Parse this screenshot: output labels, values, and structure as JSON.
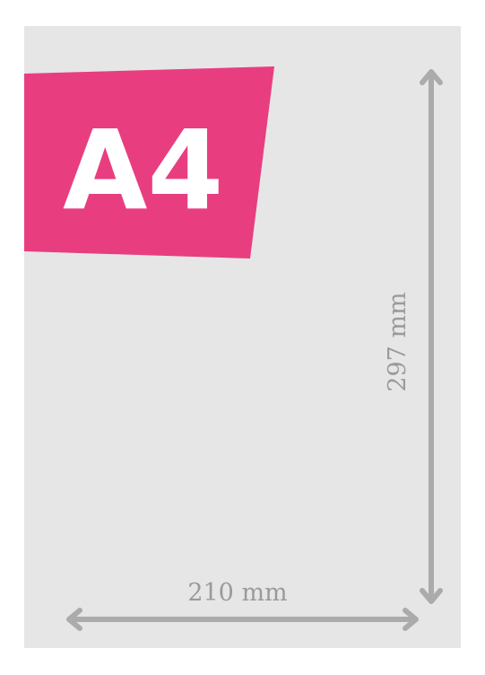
{
  "format": {
    "label": "A4",
    "banner_color": "#e83e80"
  },
  "dimensions": {
    "width_label": "210 mm",
    "height_label": "297 mm",
    "arrow_color": "#ababab",
    "sheet_color": "#e6e6e6"
  }
}
